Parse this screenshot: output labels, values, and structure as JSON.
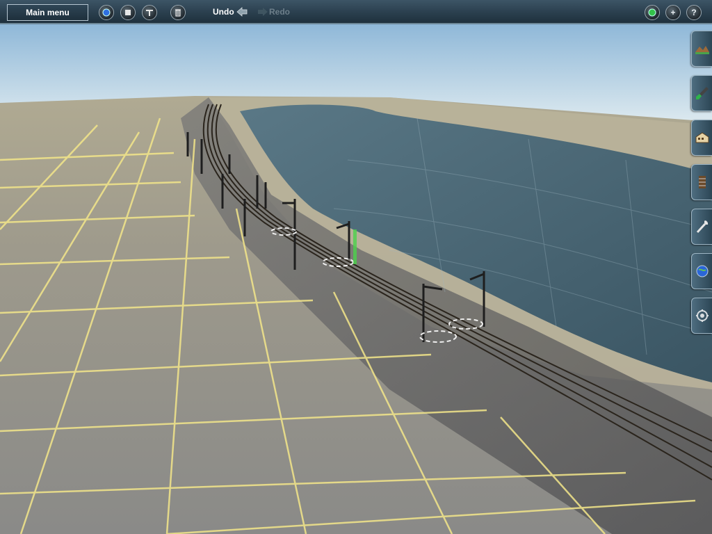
{
  "toolbar": {
    "main_menu_label": "Main menu",
    "undo_label": "Undo",
    "redo_label": "Redo",
    "icons": [
      "blue-orb-icon",
      "stop-icon",
      "tools-icon",
      "trash-icon",
      "green-orb-icon",
      "plus-icon",
      "help-icon"
    ],
    "help_symbol": "?",
    "plus_symbol": "+"
  },
  "side_tabs": [
    {
      "name": "terrain-tab",
      "icon": "terrain-icon"
    },
    {
      "name": "paint-tab",
      "icon": "paint-brush-icon"
    },
    {
      "name": "objects-tab",
      "icon": "building-icon"
    },
    {
      "name": "track-tab",
      "icon": "track-icon"
    },
    {
      "name": "tools-tab",
      "icon": "wrench-icon"
    },
    {
      "name": "world-tab",
      "icon": "globe-icon"
    },
    {
      "name": "settings-tab",
      "icon": "gear-icon"
    }
  ],
  "colors": {
    "toolbar_bg": "#2a3f4e",
    "grid_line": "#f3e68a",
    "water": "#3f5a68",
    "sky_top": "#8fb8d8",
    "sky_bottom": "#d6e6ee"
  }
}
